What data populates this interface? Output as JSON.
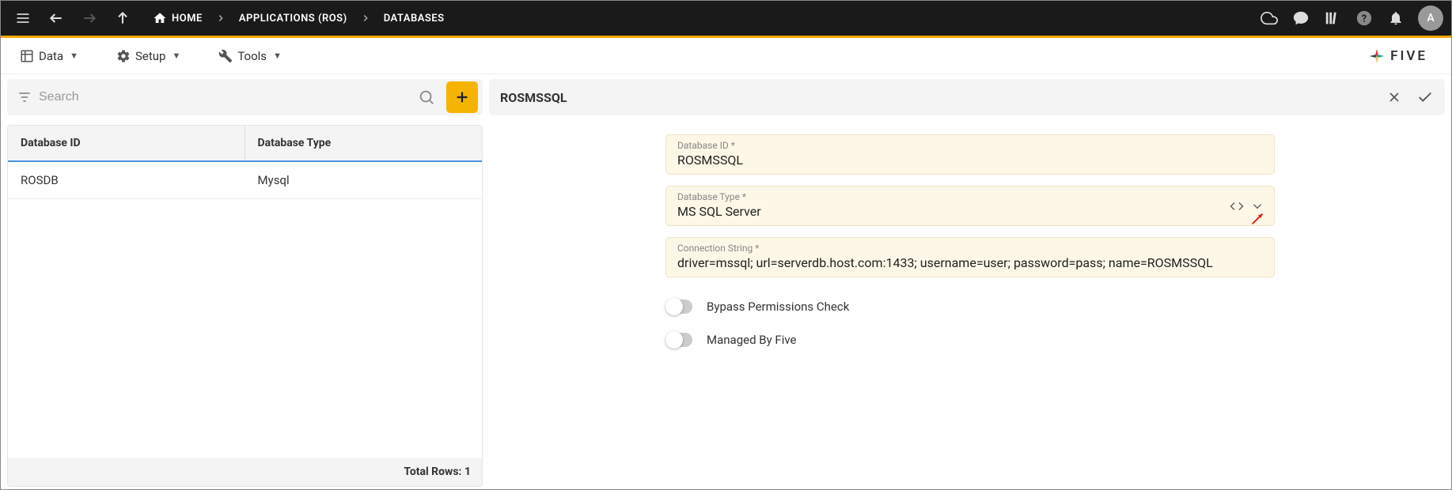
{
  "breadcrumb": {
    "home": "HOME",
    "apps": "APPLICATIONS (ROS)",
    "databases": "DATABASES"
  },
  "menubar": {
    "data": "Data",
    "setup": "Setup",
    "tools": "Tools"
  },
  "brand": "FIVE",
  "avatar_initial": "A",
  "search": {
    "placeholder": "Search"
  },
  "table": {
    "headers": {
      "col1": "Database ID",
      "col2": "Database Type"
    },
    "rows": [
      {
        "id": "ROSDB",
        "type": "Mysql"
      }
    ],
    "footer_label": "Total Rows:",
    "footer_count": "1"
  },
  "detail": {
    "title": "ROSMSSQL",
    "fields": {
      "database_id": {
        "label": "Database ID *",
        "value": "ROSMSSQL"
      },
      "database_type": {
        "label": "Database Type *",
        "value": "MS SQL Server"
      },
      "connection_string": {
        "label": "Connection String *",
        "value": "driver=mssql; url=serverdb.host.com:1433; username=user; password=pass; name=ROSMSSQL"
      }
    },
    "toggles": {
      "bypass": "Bypass Permissions Check",
      "managed": "Managed By Five"
    }
  }
}
